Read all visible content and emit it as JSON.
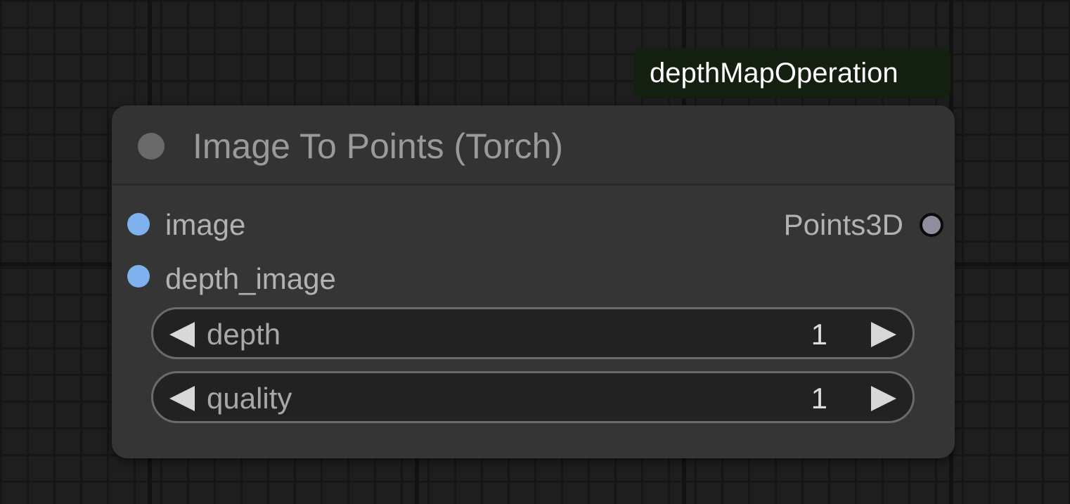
{
  "group": {
    "label": "depthMapOperation"
  },
  "node": {
    "title": "Image To Points (Torch)",
    "inputs": [
      {
        "label": "image",
        "color": "#7fb1ef"
      },
      {
        "label": "depth_image",
        "color": "#7fb1ef"
      }
    ],
    "outputs": [
      {
        "label": "Points3D",
        "color": "#8e8e9e"
      }
    ],
    "widgets": [
      {
        "label": "depth",
        "value": "1"
      },
      {
        "label": "quality",
        "value": "1"
      }
    ]
  },
  "colors": {
    "canvas_bg": "#1e1e1e",
    "node_bg": "#353535",
    "group_bg": "#14200f",
    "input_slot": "#7fb1ef",
    "output_slot": "#8e8e9e"
  }
}
